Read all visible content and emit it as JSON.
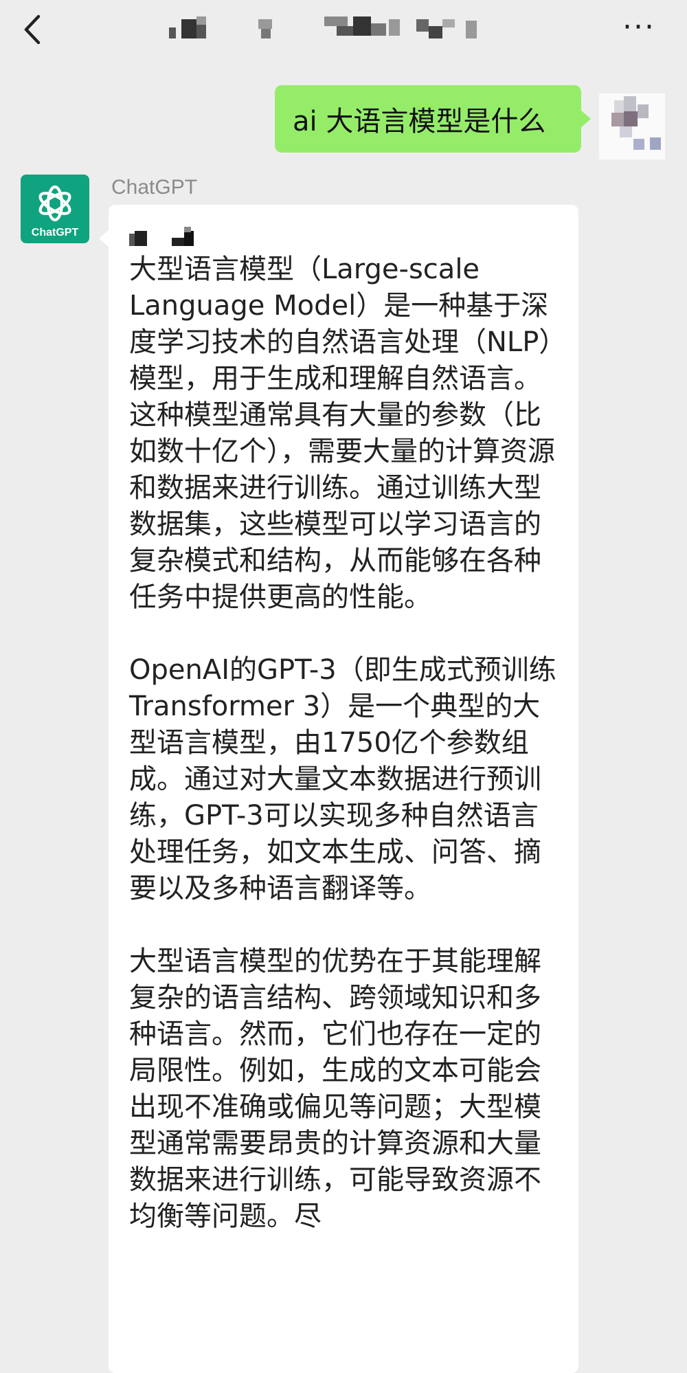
{
  "header": {
    "back_icon": "chevron-left-icon",
    "title_obscured": true,
    "more_icon": "ellipsis-icon",
    "more_label": "···"
  },
  "messages": {
    "user": {
      "text": "ai 大语言模型是什么",
      "bubble_color": "#95ec69"
    },
    "bot": {
      "sender": "ChatGPT",
      "avatar_label": "ChatGPT",
      "avatar_color": "#10a37f",
      "paragraphs": [
        "大型语言模型（Large-scale Language Model）是一种基于深度学习技术的自然语言处理（NLP）模型，用于生成和理解自然语言。这种模型通常具有大量的参数（比如数十亿个），需要大量的计算资源和数据来进行训练。通过训练大型数据集，这些模型可以学习语言的复杂模式和结构，从而能够在各种任务中提供更高的性能。",
        "OpenAI的GPT-3（即生成式预训练Transformer 3）是一个典型的大型语言模型，由1750亿个参数组成。通过对大量文本数据进行预训练，GPT-3可以实现多种自然语言处理任务，如文本生成、问答、摘要以及多种语言翻译等。",
        "大型语言模型的优势在于其能理解复杂的语言结构、跨领域知识和多种语言。然而，它们也存在一定的局限性。例如，生成的文本可能会出现不准确或偏见等问题；大型模型通常需要昂贵的计算资源和大量数据来进行训练，可能导致资源不均衡等问题。尽"
      ]
    }
  },
  "colors": {
    "background": "#ededed",
    "bubble_bot": "#ffffff"
  }
}
